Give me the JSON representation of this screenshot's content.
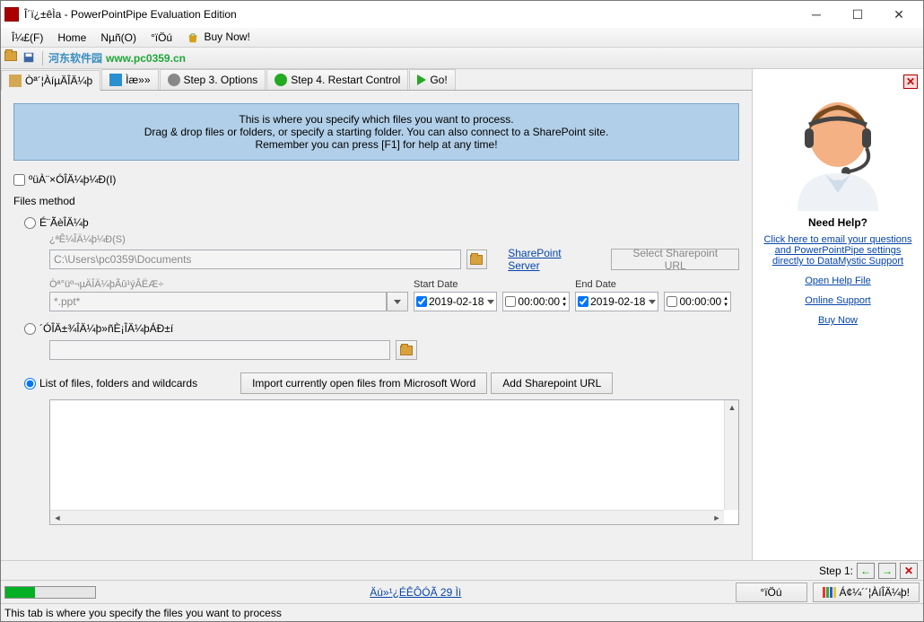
{
  "window": {
    "title": "Î´ï¿±êÌa - PowerPointPipe Evaluation Edition"
  },
  "menubar": {
    "file": "Î¼£(F)",
    "home": "Home",
    "no": "Nµñ(O)",
    "other": "°ïÖú",
    "buy": "Buy Now!"
  },
  "toolbar": {
    "url": "www.pc0359.cn",
    "brand": "河东软件园"
  },
  "tabs": {
    "t1": "Òª´¦ÀíµÄÎÄ¼þ",
    "t2": "Ìæ»»",
    "t3": "Step 3. Options",
    "t4": "Step 4. Restart Control",
    "t5": "Go!"
  },
  "banner": {
    "l1": "This is where you specify which files you want to process.",
    "l2": "Drag & drop files or folders, or specify a starting folder. You can also connect to a SharePoint site.",
    "l3": "Remember you can press [F1] for help at any time!"
  },
  "form": {
    "chk_all": "ºüÀ¨×ÓÎÄ¼þ¼Ð(I)",
    "files_method": "Files method",
    "radio1": "É¨ÃèÎÄ¼þ",
    "folder_label": "¿ªÊ¼ÎÄ¼þ¼Ð(S)",
    "folder_value": "C:\\Users\\pc0359\\Documents",
    "sp_link": "SharePoint Server",
    "sp_btn": "Select Sharepoint URL",
    "filter_label": "Òª°üº¬µÄÎÄ¼þÃû¹ýÂËÆ÷",
    "filter_value": "*.ppt*",
    "start_date_lbl": "Start Date",
    "start_date": "2019-02-18",
    "start_time": "00:00:00",
    "end_date_lbl": "End Date",
    "end_date": "2019-02-18",
    "end_time": "00:00:00",
    "radio2": "´ÓÎÄ±¾ÎÄ¼þ»ñÈ¡ÎÄ¼þÁÐ±í",
    "radio3": "List of files, folders and wildcards",
    "import_btn": "Import currently open files from Microsoft Word",
    "add_sp_btn": "Add Sharepoint URL"
  },
  "side": {
    "title": "Need Help?",
    "link1": "Click here to email your questions and PowerPointPipe settings directly to DataMystic Support",
    "link2": "Open Help File",
    "link3": "Online Support",
    "link4": "Buy Now"
  },
  "step": {
    "label": "Step 1:"
  },
  "progress": {
    "pct": 33,
    "center_link": "Äú»¹¿ÉÊÔÓÃ 29 Ìì",
    "btn1": "°ïÖú",
    "btn2": "Á¢¼´´¦ÀíÎÄ¼þ!"
  },
  "statusbar": {
    "text": "This tab is where you specify the files you want to process"
  }
}
